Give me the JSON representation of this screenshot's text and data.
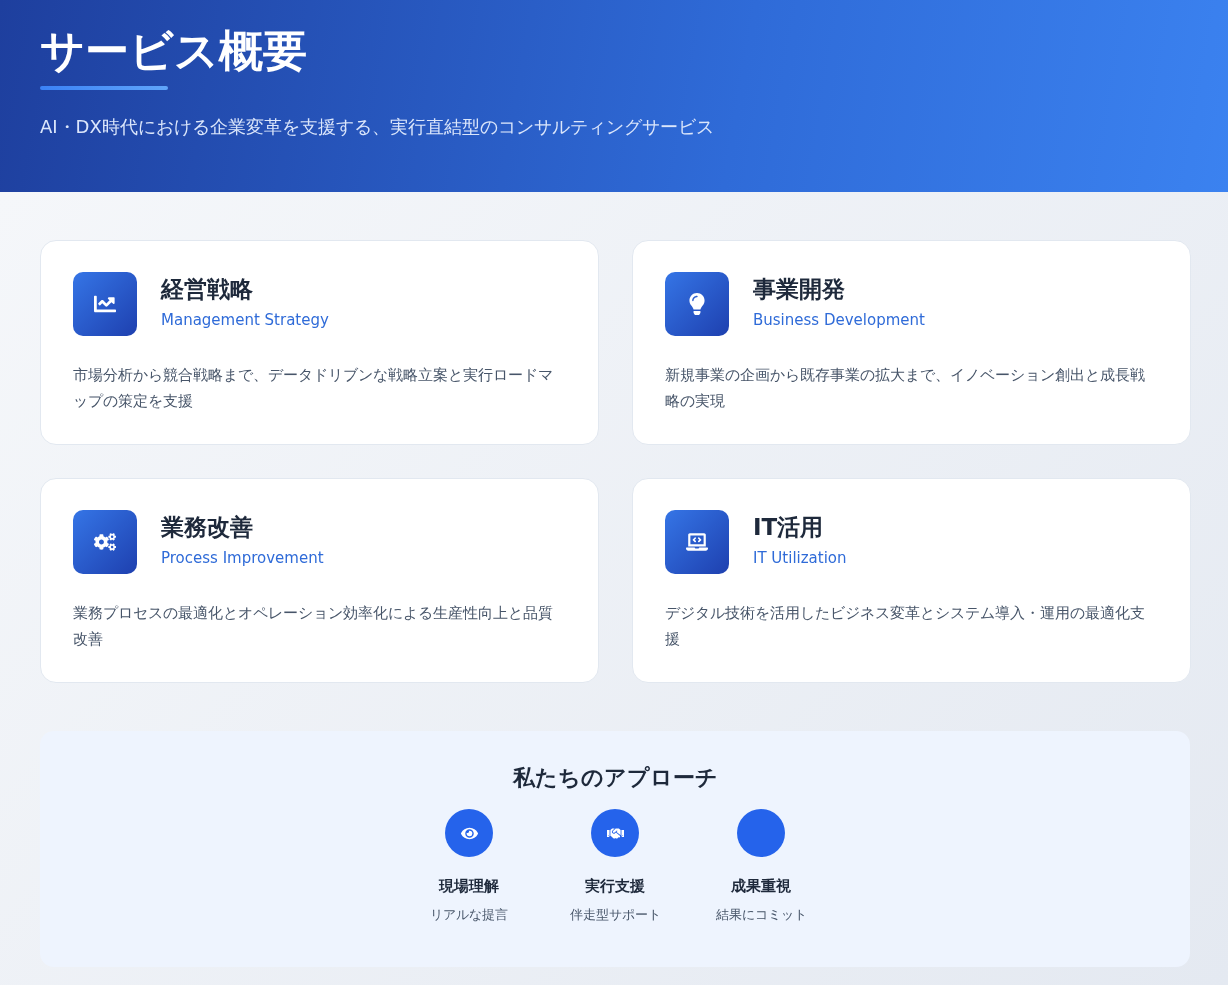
{
  "header": {
    "title": "サービス概要",
    "subtitle": "AI・DX時代における企業変革を支援する、実行直結型のコンサルティングサービス"
  },
  "services": [
    {
      "kind": "chart",
      "title": "経営戦略",
      "subtitle": "Management Strategy",
      "description": "市場分析から競合戦略まで、データドリブンな戦略立案と実行ロードマップの策定を支援"
    },
    {
      "kind": "bulb",
      "title": "事業開発",
      "subtitle": "Business Development",
      "description": "新規事業の企画から既存事業の拡大まで、イノベーション創出と成長戦略の実現"
    },
    {
      "kind": "gears",
      "title": "業務改善",
      "subtitle": "Process Improvement",
      "description": "業務プロセスの最適化とオペレーション効率化による生産性向上と品質改善"
    },
    {
      "kind": "laptop",
      "title": "IT活用",
      "subtitle": "IT Utilization",
      "description": "デジタル技術を活用したビジネス変革とシステム導入・運用の最適化支援"
    }
  ],
  "approach": {
    "title": "私たちのアプローチ",
    "items": [
      {
        "kind": "eye",
        "label": "現場理解",
        "caption": "リアルな提言"
      },
      {
        "kind": "handshake",
        "label": "実行支援",
        "caption": "伴走型サポート"
      },
      {
        "kind": "blank",
        "label": "成果重視",
        "caption": "結果にコミット"
      }
    ]
  }
}
